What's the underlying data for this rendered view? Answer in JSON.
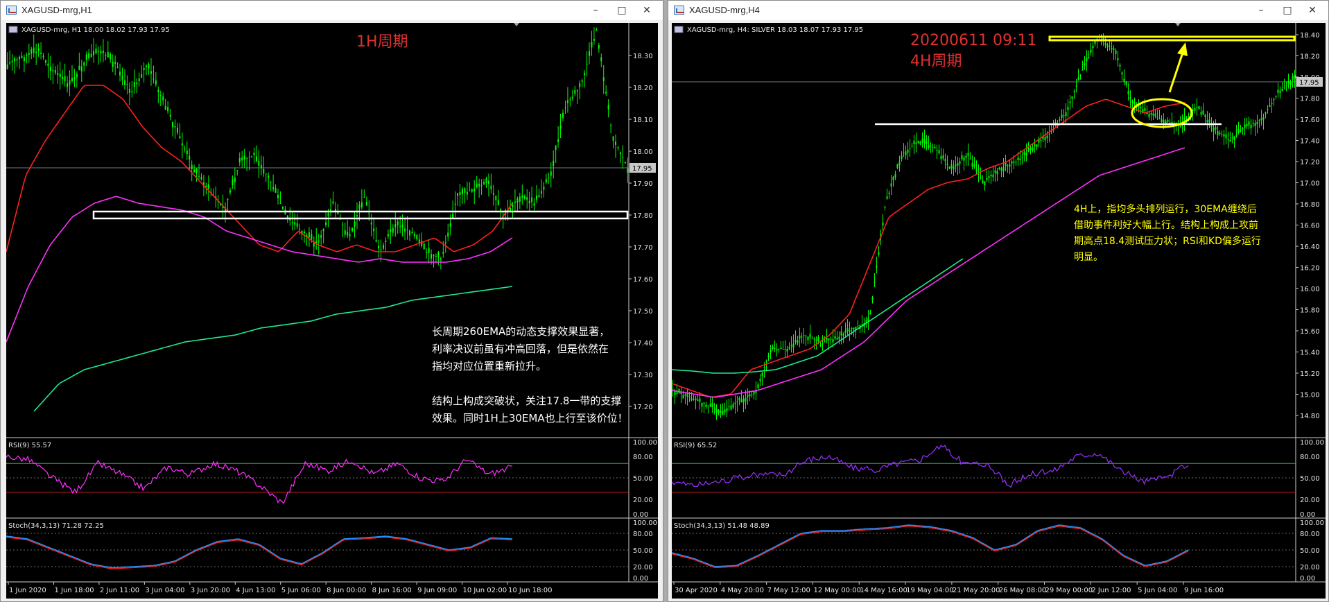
{
  "windows": [
    {
      "id": "w1",
      "title": "XAGUSD-mrg,H1",
      "controls": {
        "minimize": "–",
        "maximize": "□",
        "close": "✕"
      },
      "info_line": "XAGUSD-mrg, H1  18.00 18.02 17.93 17.95",
      "annotation_title": "1H周期",
      "annotation_text": [
        "长周期260EMA的动态支撑效果显著，",
        "利率决议前虽有冲高回落，但是依然在",
        "指均对应位置重新拉升。",
        "",
        "结构上构成突破状，关注17.8一带的支撑",
        "效果。同时1H上30EMA也上行至该价位！"
      ],
      "price_axis": [
        "18.30",
        "18.20",
        "18.10",
        "18.00",
        "17.90",
        "17.80",
        "17.70",
        "17.60",
        "17.50",
        "17.40",
        "17.30",
        "17.20"
      ],
      "current_price": "17.95",
      "rsi_label": "RSI(9) 55.57",
      "rsi_axis": [
        "100.00",
        "80.00",
        "50.00",
        "20.00",
        "0.00"
      ],
      "stoch_label": "Stoch(34,3,13) 71.28 72.25",
      "stoch_axis": [
        "100.00",
        "80.00",
        "50.00",
        "20.00",
        "0.00"
      ],
      "time_axis": [
        "1 Jun 2020",
        "1 Jun 18:00",
        "2 Jun 11:00",
        "3 Jun 04:00",
        "3 Jun 20:00",
        "4 Jun 13:00",
        "5 Jun 06:00",
        "8 Jun 00:00",
        "8 Jun 16:00",
        "9 Jun 09:00",
        "10 Jun 02:00",
        "10 Jun 18:00"
      ]
    },
    {
      "id": "w2",
      "title": "XAGUSD-mrg,H4",
      "controls": {
        "minimize": "–",
        "maximize": "□",
        "close": "✕"
      },
      "info_line": "XAGUSD-mrg, H4: SILVER  18.03 18.07 17.93 17.95",
      "annotation_title": "20200611 09:11",
      "annotation_subtitle": "4H周期",
      "annotation_text": [
        "4H上，指均多头排列运行，30EMA缠绕后",
        "借助事件利好大幅上行。结构上构成上攻前",
        "期高点18.4测试压力状；RSI和KD偏多运行",
        "明显。"
      ],
      "price_axis": [
        "18.40",
        "18.20",
        "18.00",
        "17.80",
        "17.60",
        "17.40",
        "17.20",
        "17.00",
        "16.80",
        "16.60",
        "16.40",
        "16.20",
        "16.00",
        "15.80",
        "15.60",
        "15.40",
        "15.20",
        "15.00",
        "14.80"
      ],
      "current_price": "17.95",
      "rsi_label": "RSI(9) 65.52",
      "rsi_axis": [
        "100.00",
        "80.00",
        "50.00",
        "20.00",
        "0.00"
      ],
      "stoch_label": "Stoch(34,3,13) 51.48 48.89",
      "stoch_axis": [
        "100.00",
        "80.00",
        "50.00",
        "20.00",
        "0.00"
      ],
      "time_axis": [
        "30 Apr 2020",
        "4 May 20:00",
        "7 May 12:00",
        "12 May 00:00",
        "14 May 16:00",
        "19 May 04:00",
        "21 May 20:00",
        "26 May 08:00",
        "29 May 00:00",
        "2 Jun 12:00",
        "5 Jun 04:00",
        "9 Jun 16:00"
      ]
    }
  ],
  "colors": {
    "background": "#000000",
    "candles": "#00ff00",
    "ema30": "#ff2020",
    "ema_mid": "#ff30ff",
    "ema260": "#20e890",
    "annotation_title": "#e03030",
    "annotation_text_w1": "#ffffff",
    "annotation_text_w2": "#ffff00",
    "support_box": "#ffffff",
    "resistance_box": "#ffff00",
    "rsi_w1": "#ff30ff",
    "rsi_w2": "#9a30ff",
    "stoch_main": "#2090ff",
    "stoch_signal": "#ff2020"
  }
}
